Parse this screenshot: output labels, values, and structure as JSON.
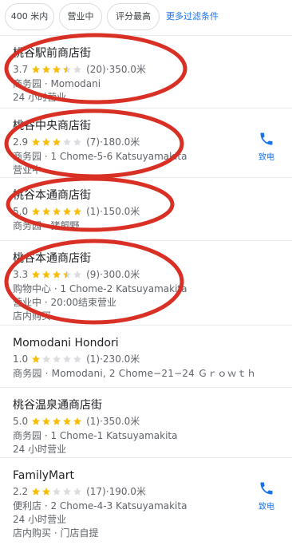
{
  "filters": {
    "chips": [
      "400 米内",
      "营业中",
      "评分最高"
    ],
    "more": "更多过滤条件"
  },
  "colors": {
    "star_on": "#fbbc04",
    "star_off": "#dadce0",
    "accent": "#1a73e8",
    "annotation": "#d93025"
  },
  "call_label": "致电",
  "listings": [
    {
      "name": "桃谷駅前商店街",
      "rating": "3.7",
      "stars": 3.5,
      "reviews": "(20)",
      "distance": "350.0米",
      "lines": [
        "商务园 · Momodani",
        "24 小时营业"
      ],
      "has_call": false,
      "circled": true
    },
    {
      "name": "桃谷中央商店街",
      "rating": "2.9",
      "stars": 3,
      "reviews": "(7)",
      "distance": "180.0米",
      "lines": [
        "商务园 · 1 Chome-5-6 Katsuyamakita",
        "营业中"
      ],
      "has_call": true,
      "circled": true
    },
    {
      "name": "桃谷本通商店街",
      "rating": "5.0",
      "stars": 5,
      "reviews": "(1)",
      "distance": "150.0米",
      "lines": [
        "商务园 · 猪飼野"
      ],
      "has_call": false,
      "circled": true
    },
    {
      "name": "桃谷本通商店街",
      "rating": "3.3",
      "stars": 3.5,
      "reviews": "(9)",
      "distance": "300.0米",
      "lines": [
        "购物中心 · 1 Chome-2 Katsuyamakita",
        "营业中 · 20:00结束营业",
        "店内购买"
      ],
      "has_call": false,
      "circled": true
    },
    {
      "name": "Momodani Hondori",
      "rating": "1.0",
      "stars": 1,
      "reviews": "(1)",
      "distance": "230.0米",
      "lines": [
        "商务园 · Momodani, 2 Chome−21−24 Ｇｒｏｗｔｈ"
      ],
      "has_call": false,
      "circled": false
    },
    {
      "name": "桃谷温泉通商店街",
      "rating": "5.0",
      "stars": 5,
      "reviews": "(1)",
      "distance": "350.0米",
      "lines": [
        "商务园 · 1 Chome-1 Katsuyamakita",
        "24 小时营业"
      ],
      "has_call": false,
      "circled": false
    },
    {
      "name": "FamilyMart",
      "rating": "2.2",
      "stars": 2,
      "reviews": "(17)",
      "distance": "190.0米",
      "lines": [
        "便利店 · 2 Chome-4-3 Katsuyamakita",
        "24 小时营业",
        "店内购买 · 门店自提"
      ],
      "has_call": true,
      "circled": false
    }
  ]
}
